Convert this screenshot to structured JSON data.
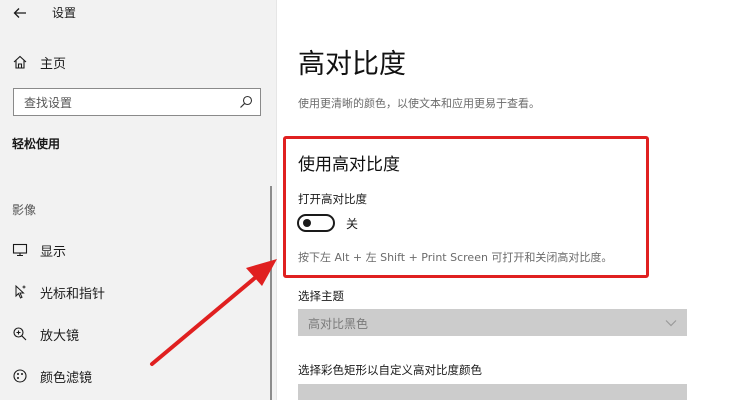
{
  "app": {
    "title": "设置"
  },
  "sidebar": {
    "home_label": "主页",
    "search_placeholder": "查找设置",
    "section_title": "轻松使用",
    "group_label": "影像",
    "items": [
      {
        "label": "显示",
        "icon": "monitor-icon"
      },
      {
        "label": "光标和指针",
        "icon": "cursor-icon"
      },
      {
        "label": "放大镜",
        "icon": "magnifier-icon"
      },
      {
        "label": "颜色滤镜",
        "icon": "color-filter-icon"
      }
    ]
  },
  "main": {
    "title": "高对比度",
    "description": "使用更清晰的颜色，以使文本和应用更易于查看。",
    "high_contrast": {
      "heading": "使用高对比度",
      "toggle_label": "打开高对比度",
      "toggle_state": "关",
      "toggle_on": false,
      "hint": "按下左 Alt + 左 Shift + Print Screen 可打开和关闭高对比度。"
    },
    "theme": {
      "label": "选择主题",
      "selected": "高对比黑色"
    },
    "custom_colors_label": "选择彩色矩形以自定义高对比度颜色"
  },
  "colors": {
    "annotation": "#e02020",
    "sidebar_bg": "#f2f2f2",
    "disabled_select_bg": "#cccccc"
  }
}
